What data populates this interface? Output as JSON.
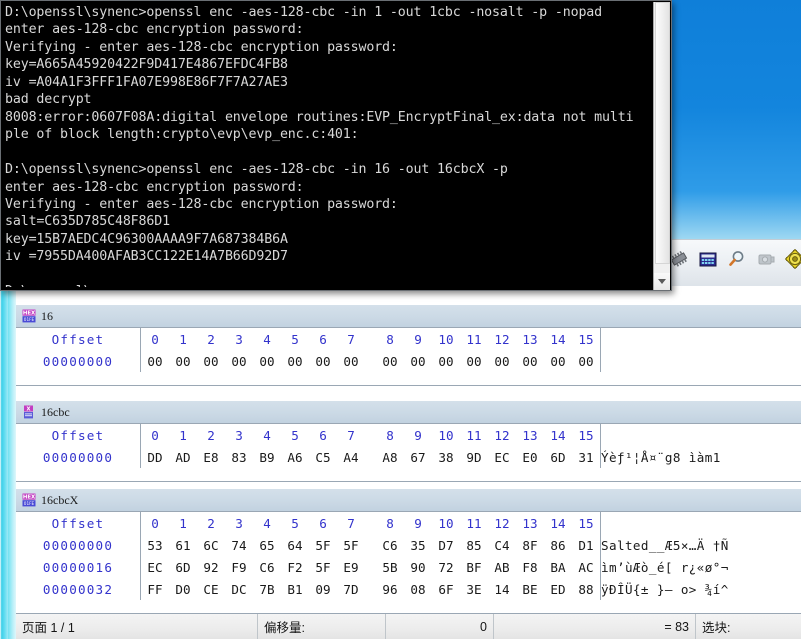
{
  "console": {
    "name": "command-prompt",
    "lines": [
      "D:\\openssl\\synenc>openssl enc -aes-128-cbc -in 1 -out 1cbc -nosalt -p -nopad",
      "enter aes-128-cbc encryption password:",
      "Verifying - enter aes-128-cbc encryption password:",
      "key=A665A45920422F9D417E4867EFDC4FB8",
      "iv =A04A1F3FFF1FA07E998E86F7F7A27AE3",
      "bad decrypt",
      "8008:error:0607F08A:digital envelope routines:EVP_EncryptFinal_ex:data not multi",
      "ple of block length:crypto\\evp\\evp_enc.c:401:",
      "",
      "D:\\openssl\\synenc>openssl enc -aes-128-cbc -in 16 -out 16cbcX -p",
      "enter aes-128-cbc encryption password:",
      "Verifying - enter aes-128-cbc encryption password:",
      "salt=C635D785C48F86D1",
      "key=15B7AEDC4C96300AAAA9F7A687384B6A",
      "iv =7955DA400AFAB3CC122E14A7B66D92D7",
      "",
      "D:\\openssl\\synenc>"
    ],
    "scrollbar": {
      "down_arrow_icon": "chevron-down-icon"
    }
  },
  "toolbar": {
    "icons": [
      "chip-icon",
      "calculator-icon",
      "magnifier-icon",
      "camera-icon",
      "gear-icon"
    ]
  },
  "hex_columns": {
    "offset_header": "Offset",
    "byte_headers": [
      "0",
      "1",
      "2",
      "3",
      "4",
      "5",
      "6",
      "7",
      "8",
      "9",
      "10",
      "11",
      "12",
      "13",
      "14",
      "15"
    ]
  },
  "panes": [
    {
      "title": "16",
      "icon": "hex-document-icon",
      "rows": [
        {
          "offset": "00000000",
          "bytes": [
            "00",
            "00",
            "00",
            "00",
            "00",
            "00",
            "00",
            "00",
            "00",
            "00",
            "00",
            "00",
            "00",
            "00",
            "00",
            "00"
          ],
          "ascii": ""
        }
      ]
    },
    {
      "title": "16cbc",
      "icon": "hex-document-icon",
      "rows": [
        {
          "offset": "00000000",
          "bytes": [
            "DD",
            "AD",
            "E8",
            "83",
            "B9",
            "A6",
            "C5",
            "A4",
            "A8",
            "67",
            "38",
            "9D",
            "EC",
            "E0",
            "6D",
            "31"
          ],
          "ascii": "Ý­èƒ¹¦Å¤¨g8 ìàm1"
        }
      ]
    },
    {
      "title": "16cbcX",
      "icon": "hex-document-icon",
      "rows": [
        {
          "offset": "00000000",
          "bytes": [
            "53",
            "61",
            "6C",
            "74",
            "65",
            "64",
            "5F",
            "5F",
            "C6",
            "35",
            "D7",
            "85",
            "C4",
            "8F",
            "86",
            "D1"
          ],
          "ascii": "Salted__Æ5×…Ä †Ñ"
        },
        {
          "offset": "00000016",
          "bytes": [
            "EC",
            "6D",
            "92",
            "F9",
            "C6",
            "F2",
            "5F",
            "E9",
            "5B",
            "90",
            "72",
            "BF",
            "AB",
            "F8",
            "BA",
            "AC"
          ],
          "ascii": "ìm’ùÆò_é[ r¿«ø°¬"
        },
        {
          "offset": "00000032",
          "bytes": [
            "FF",
            "D0",
            "CE",
            "DC",
            "7B",
            "B1",
            "09",
            "7D",
            "96",
            "08",
            "6F",
            "3E",
            "14",
            "BE",
            "ED",
            "88"
          ],
          "ascii": "ÿÐÎÜ{± }– o> ¾í^"
        }
      ]
    }
  ],
  "statusbar": {
    "page_label": "页面 1 / 1",
    "offset_label": "偏移量:",
    "offset_value": "0",
    "equals_value": "= 83",
    "selection_label": "选块:"
  },
  "colors": {
    "console_bg": "#000000",
    "console_fg": "#d8d8d8",
    "hex_offset_blue": "#3333cc",
    "pane_title_bg": "#ccdae6",
    "window_border_cyan": "#5fdcf0",
    "desktop_blue": "#1385dd"
  }
}
